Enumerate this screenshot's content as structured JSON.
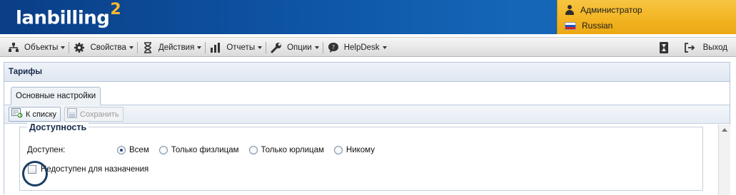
{
  "brand": {
    "name": "lanbilling",
    "superscript": "2",
    "accent_color": "#f5b82e"
  },
  "user": {
    "name": "Администратор",
    "language": "Russian"
  },
  "menu": {
    "items": [
      {
        "label": "Объекты",
        "icon": "tree-icon"
      },
      {
        "label": "Свойства",
        "icon": "gear-icon"
      },
      {
        "label": "Действия",
        "icon": "hourglass-icon"
      },
      {
        "label": "Отчеты",
        "icon": "bar-chart-icon"
      },
      {
        "label": "Опции",
        "icon": "wrench-icon"
      },
      {
        "label": "HelpDesk",
        "icon": "speech-bubble-icon"
      }
    ],
    "logout_label": "Выход"
  },
  "panel": {
    "title": "Тарифы",
    "tab_label": "Основные настройки",
    "toolbar": {
      "back_label": "К списку",
      "save_label": "Сохранить"
    }
  },
  "availability": {
    "legend": "Доступность",
    "available_label": "Доступен:",
    "options": [
      {
        "label": "Всем",
        "selected": true
      },
      {
        "label": "Только физлицам",
        "selected": false
      },
      {
        "label": "Только юрлицам",
        "selected": false
      },
      {
        "label": "Никому",
        "selected": false
      }
    ],
    "unavailable_checkbox": {
      "label": "Недоступен для назначения",
      "checked": false
    }
  }
}
